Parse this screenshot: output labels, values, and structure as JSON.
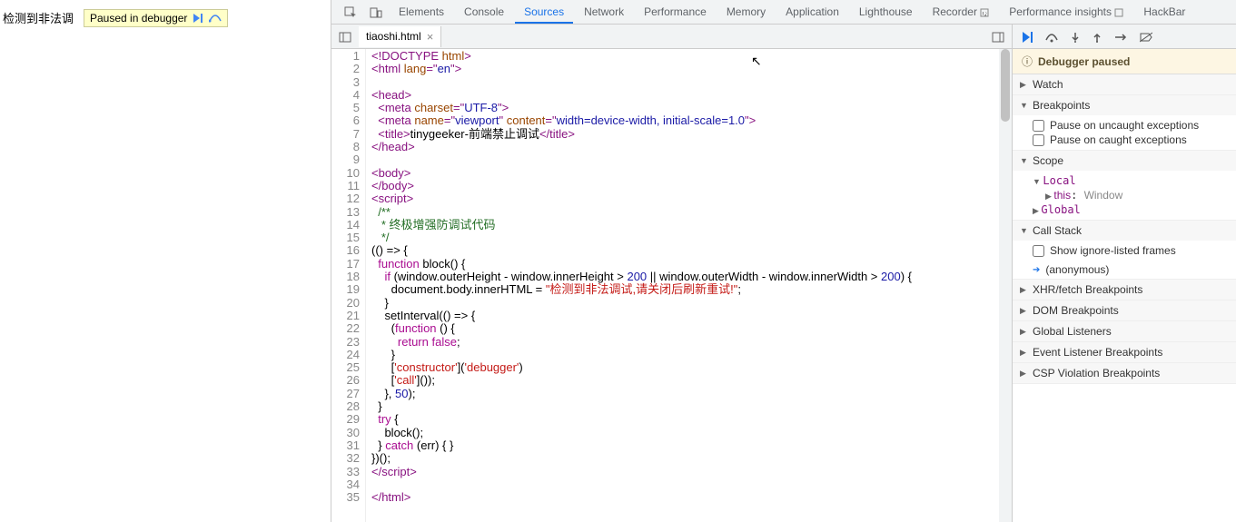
{
  "page": {
    "body_text": "检测到非法调"
  },
  "overlay": {
    "label": "Paused in debugger"
  },
  "tabs": [
    "Elements",
    "Console",
    "Sources",
    "Network",
    "Performance",
    "Memory",
    "Application",
    "Lighthouse",
    "Recorder",
    "Performance insights",
    "HackBar"
  ],
  "active_tab": "Sources",
  "file_tab": {
    "name": "tiaoshi.html"
  },
  "code_lines": [
    [
      {
        "t": "<!DOCTYPE ",
        "c": "tag"
      },
      {
        "t": "html",
        "c": "attr"
      },
      {
        "t": ">",
        "c": "tag"
      }
    ],
    [
      {
        "t": "<html ",
        "c": "tag"
      },
      {
        "t": "lang",
        "c": "attr"
      },
      {
        "t": "=\"",
        "c": "tag"
      },
      {
        "t": "en",
        "c": "str"
      },
      {
        "t": "\">",
        "c": "tag"
      }
    ],
    [],
    [
      {
        "t": "<head>",
        "c": "tag"
      }
    ],
    [
      {
        "t": "  ",
        "c": ""
      },
      {
        "t": "<meta ",
        "c": "tag"
      },
      {
        "t": "charset",
        "c": "attr"
      },
      {
        "t": "=\"",
        "c": "tag"
      },
      {
        "t": "UTF-8",
        "c": "str"
      },
      {
        "t": "\">",
        "c": "tag"
      }
    ],
    [
      {
        "t": "  ",
        "c": ""
      },
      {
        "t": "<meta ",
        "c": "tag"
      },
      {
        "t": "name",
        "c": "attr"
      },
      {
        "t": "=\"",
        "c": "tag"
      },
      {
        "t": "viewport",
        "c": "str"
      },
      {
        "t": "\" ",
        "c": "tag"
      },
      {
        "t": "content",
        "c": "attr"
      },
      {
        "t": "=\"",
        "c": "tag"
      },
      {
        "t": "width=device-width, initial-scale=1.0",
        "c": "str"
      },
      {
        "t": "\">",
        "c": "tag"
      }
    ],
    [
      {
        "t": "  ",
        "c": ""
      },
      {
        "t": "<title>",
        "c": "tag"
      },
      {
        "t": "tinygeeker-前端禁止调试",
        "c": ""
      },
      {
        "t": "</title>",
        "c": "tag"
      }
    ],
    [
      {
        "t": "</head>",
        "c": "tag"
      }
    ],
    [],
    [
      {
        "t": "<body>",
        "c": "tag"
      }
    ],
    [
      {
        "t": "</body>",
        "c": "tag"
      }
    ],
    [
      {
        "t": "<script>",
        "c": "tag"
      }
    ],
    [
      {
        "t": "  /**",
        "c": "cmt"
      }
    ],
    [
      {
        "t": "   * 终极增强防调试代码",
        "c": "cmt"
      }
    ],
    [
      {
        "t": "   */",
        "c": "cmt"
      }
    ],
    [
      {
        "t": "(() => {",
        "c": ""
      }
    ],
    [
      {
        "t": "  ",
        "c": ""
      },
      {
        "t": "function",
        "c": "kw"
      },
      {
        "t": " block() {",
        "c": ""
      }
    ],
    [
      {
        "t": "    ",
        "c": ""
      },
      {
        "t": "if",
        "c": "kw"
      },
      {
        "t": " (window.outerHeight - window.innerHeight > ",
        "c": ""
      },
      {
        "t": "200",
        "c": "num"
      },
      {
        "t": " || window.outerWidth - window.innerWidth > ",
        "c": ""
      },
      {
        "t": "200",
        "c": "num"
      },
      {
        "t": ") {",
        "c": ""
      }
    ],
    [
      {
        "t": "      document.body.innerHTML = ",
        "c": ""
      },
      {
        "t": "\"检测到非法调试,请关闭后刷新重试!\"",
        "c": "strlit"
      },
      {
        "t": ";",
        "c": ""
      }
    ],
    [
      {
        "t": "    }",
        "c": ""
      }
    ],
    [
      {
        "t": "    setInterval(() => {",
        "c": ""
      }
    ],
    [
      {
        "t": "      (",
        "c": ""
      },
      {
        "t": "function",
        "c": "kw"
      },
      {
        "t": " () {",
        "c": ""
      }
    ],
    [
      {
        "t": "        ",
        "c": ""
      },
      {
        "t": "return false",
        "c": "kw"
      },
      {
        "t": ";",
        "c": ""
      }
    ],
    [
      {
        "t": "      }",
        "c": ""
      }
    ],
    [
      {
        "t": "      [",
        "c": ""
      },
      {
        "t": "'constructor'",
        "c": "strlit"
      },
      {
        "t": "](",
        "c": ""
      },
      {
        "t": "'debugger'",
        "c": "strlit"
      },
      {
        "t": ")",
        "c": ""
      }
    ],
    [
      {
        "t": "      [",
        "c": ""
      },
      {
        "t": "'call'",
        "c": "strlit"
      },
      {
        "t": "]());",
        "c": ""
      }
    ],
    [
      {
        "t": "    }, ",
        "c": ""
      },
      {
        "t": "50",
        "c": "num"
      },
      {
        "t": ");",
        "c": ""
      }
    ],
    [
      {
        "t": "  }",
        "c": ""
      }
    ],
    [
      {
        "t": "  ",
        "c": ""
      },
      {
        "t": "try",
        "c": "kw"
      },
      {
        "t": " {",
        "c": ""
      }
    ],
    [
      {
        "t": "    block();",
        "c": ""
      }
    ],
    [
      {
        "t": "  } ",
        "c": ""
      },
      {
        "t": "catch",
        "c": "kw"
      },
      {
        "t": " (err) { }",
        "c": ""
      }
    ],
    [
      {
        "t": "})();",
        "c": ""
      }
    ],
    [
      {
        "t": "</script>",
        "c": "tag"
      }
    ],
    [],
    [
      {
        "t": "</html>",
        "c": "tag"
      }
    ]
  ],
  "debugger": {
    "paused_msg": "Debugger paused",
    "sections": {
      "watch": "Watch",
      "breakpoints": "Breakpoints",
      "pause_uncaught": "Pause on uncaught exceptions",
      "pause_caught": "Pause on caught exceptions",
      "scope": "Scope",
      "local_label": "Local",
      "this_label": "this",
      "this_value": "Window",
      "global_label": "Global",
      "callstack": "Call Stack",
      "ignore_listed": "Show ignore-listed frames",
      "anon": "(anonymous)",
      "xhr": "XHR/fetch Breakpoints",
      "dom": "DOM Breakpoints",
      "globalL": "Global Listeners",
      "evt": "Event Listener Breakpoints",
      "csp": "CSP Violation Breakpoints"
    }
  }
}
